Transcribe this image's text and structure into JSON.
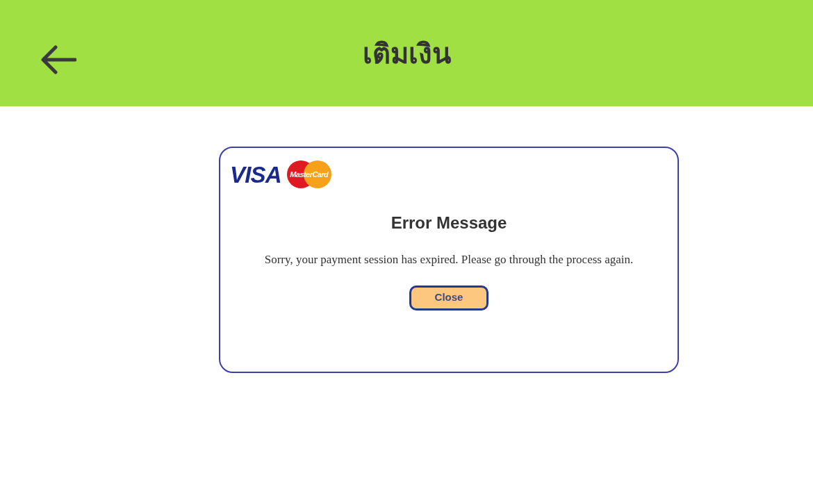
{
  "header": {
    "title": "เติมเงิน"
  },
  "dialog": {
    "logos": {
      "visa": "VISA",
      "mastercard": "MasterCard"
    },
    "title": "Error Message",
    "message": "Sorry, your payment session has expired. Please go through the process again.",
    "button": "Close"
  }
}
